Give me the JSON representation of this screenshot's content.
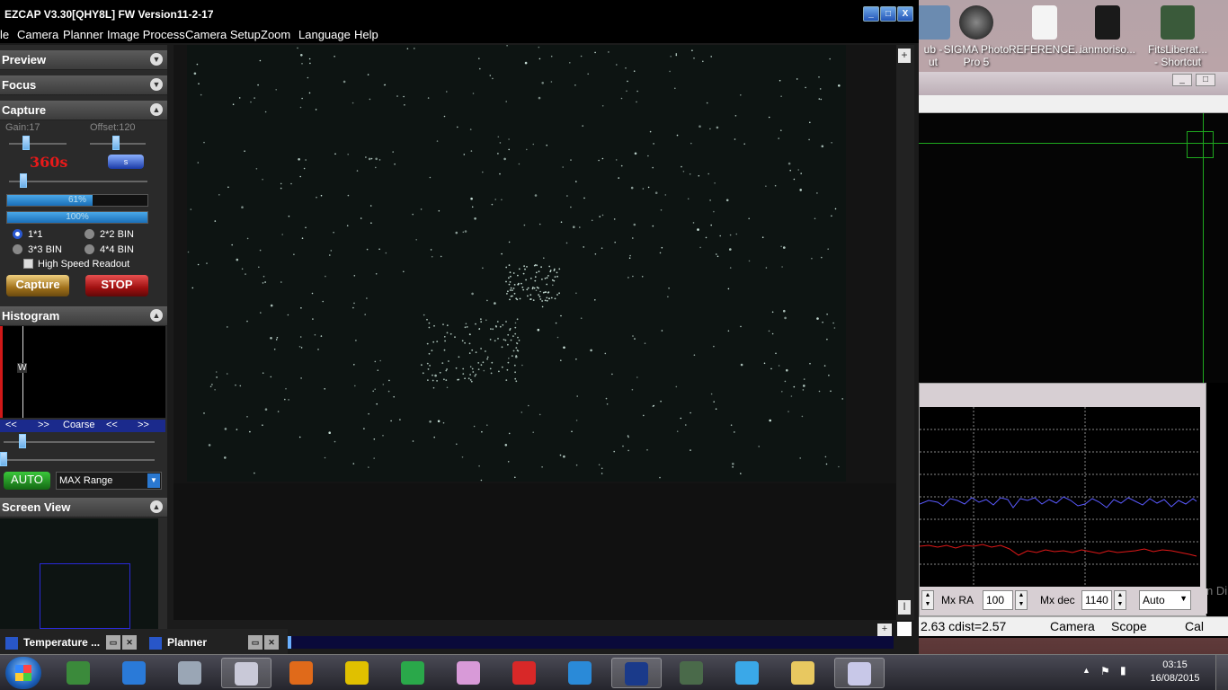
{
  "window": {
    "title": "EZCAP V3.30[QHY8L] FW Version11-2-17",
    "btn_min": "_",
    "btn_max": "□",
    "btn_close": "X"
  },
  "menu": [
    "le",
    "Camera",
    "Planner",
    "Image Process",
    "Camera Setup",
    "Zoom",
    "Language",
    "Help"
  ],
  "panels": {
    "preview": "Preview",
    "focus": "Focus",
    "capture": "Capture",
    "histogram": "Histogram",
    "screen_view": "Screen View"
  },
  "capture": {
    "gain_label": "Gain:17",
    "offset_label": "Offset:120",
    "exposure": "360s",
    "unit": "s",
    "progress1_text": "61%",
    "progress1_value": 61,
    "progress2_text": "100%",
    "progress2_value": 100,
    "bin_1": "1*1",
    "bin_2": "2*2 BIN",
    "bin_3": "3*3 BIN",
    "bin_4": "4*4 BIN",
    "high_speed": "High Speed Readout",
    "capture_btn": "Capture",
    "stop_btn": "STOP"
  },
  "histogram": {
    "w_marker": "W",
    "nav_left1": "<<",
    "nav_right1": ">>",
    "coarse": "Coarse",
    "nav_left2": "<<",
    "nav_right2": ">>",
    "auto_btn": "AUTO",
    "range_select": "MAX Range"
  },
  "subwindows": [
    {
      "title": "Temperature ..."
    },
    {
      "title": "Planner"
    }
  ],
  "desktop_icons": [
    {
      "label1": "ub -",
      "label2": "ut",
      "color": "#6b8bb0"
    },
    {
      "label1": "SIGMA Photo",
      "label2": "Pro 5",
      "color": "#222222"
    },
    {
      "label1": "REFERENCE...",
      "label2": "",
      "color": "#f4f4f4"
    },
    {
      "label1": "ianmoriso...",
      "label2": "",
      "color": "#1a1a1a"
    },
    {
      "label1": "FitsLiberat...",
      "label2": "- Shortcut",
      "color": "#3a5a3a"
    }
  ],
  "guiding": {
    "mx_ra_label": "Mx RA",
    "mx_ra_value": "100",
    "mx_dec_label": "Mx dec",
    "mx_dec_value": "1140",
    "mode": "Auto",
    "partial_right": "n Di"
  },
  "statusbar": {
    "dist": "2.63 cdist=2.57",
    "camera": "Camera",
    "scope": "Scope",
    "cal": "Cal"
  },
  "taskbar": {
    "apps": [
      {
        "name": "photo-viewer",
        "color": "#3b8a3b"
      },
      {
        "name": "media-player",
        "color": "#2a7ad8"
      },
      {
        "name": "calculator",
        "color": "#9aa6b5"
      },
      {
        "name": "ezcap",
        "color": "#c9c9d8"
      },
      {
        "name": "firefox",
        "color": "#e06a1a"
      },
      {
        "name": "maze-tool",
        "color": "#e0c000"
      },
      {
        "name": "chrome",
        "color": "#2aa84a"
      },
      {
        "name": "pen-tool",
        "color": "#d89ad8"
      },
      {
        "name": "red-globe",
        "color": "#d82828"
      },
      {
        "name": "feather-app",
        "color": "#2a8ad8"
      },
      {
        "name": "star-app",
        "color": "#1a3a8a"
      },
      {
        "name": "eagle-app",
        "color": "#4a6a4a"
      },
      {
        "name": "users-app",
        "color": "#3aa8e8"
      },
      {
        "name": "explorer",
        "color": "#e8c860"
      },
      {
        "name": "phd-app",
        "color": "#c8c8e8"
      }
    ],
    "time": "03:15",
    "date": "16/08/2015"
  }
}
